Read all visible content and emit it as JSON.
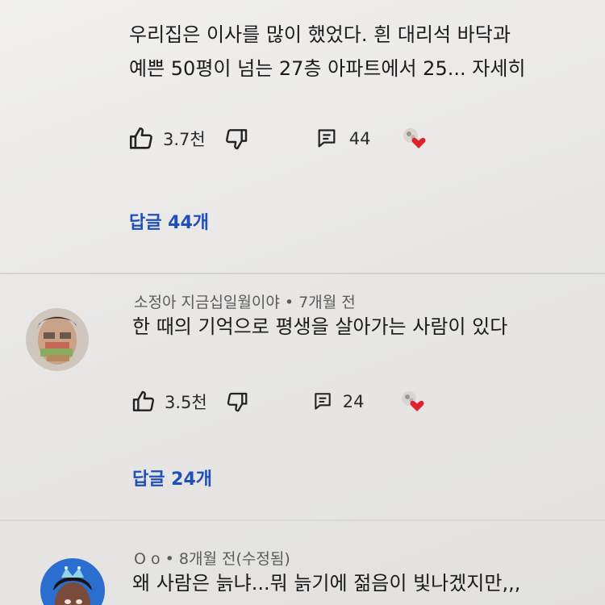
{
  "comments": [
    {
      "author": "",
      "time": "",
      "text_lines": [
        "우리집은 이사를 많이 했었다. 흰 대리석 바닥과",
        "예쁜 50평이 넘는 27층 아파트에서 25...  자세히"
      ],
      "likes": "3.7천",
      "reply_count": "44",
      "replies_label": "답글 44개"
    },
    {
      "author": "소정아 지금십일월이야",
      "time": "• 7개월 전",
      "text_lines": [
        "한 때의 기억으로 평생을 살아가는 사람이 있다"
      ],
      "likes": "3.5천",
      "reply_count": "24",
      "replies_label": "답글 24개"
    },
    {
      "author": "O o",
      "time": "• 8개월 전(수정됨)",
      "text_lines": [
        "왜 사람은 늙냐...뭐 늙기에 젊음이 빛나겠지만,,,"
      ]
    }
  ],
  "icons": {
    "like": "thumbs-up-icon",
    "dislike": "thumbs-down-icon",
    "reply": "reply-comment-icon",
    "creator_heart": "creator-heart-icon"
  },
  "colors": {
    "link": "#1f4fb8",
    "heart": "#e0202b"
  }
}
